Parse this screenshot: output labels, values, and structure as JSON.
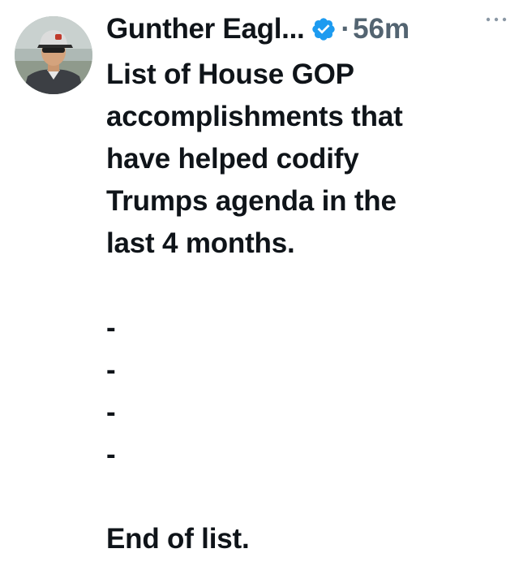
{
  "author": {
    "display_name": "Gunther Eagl...",
    "verified": true,
    "avatar_icon": "profile-photo-man-in-cap"
  },
  "meta": {
    "separator": "·",
    "timestamp": "56m"
  },
  "more_icon": "more-horizontal-icon",
  "tweet": {
    "lines": [
      "List of House GOP",
      "accomplishments that",
      "have helped codify",
      "Trumps agenda in the",
      "last 4 months.",
      "",
      "-",
      "-",
      "-",
      "-",
      "",
      "End of list."
    ]
  },
  "colors": {
    "text": "#0f1419",
    "secondary": "#536471",
    "verified_blue": "#1d9bf0"
  }
}
